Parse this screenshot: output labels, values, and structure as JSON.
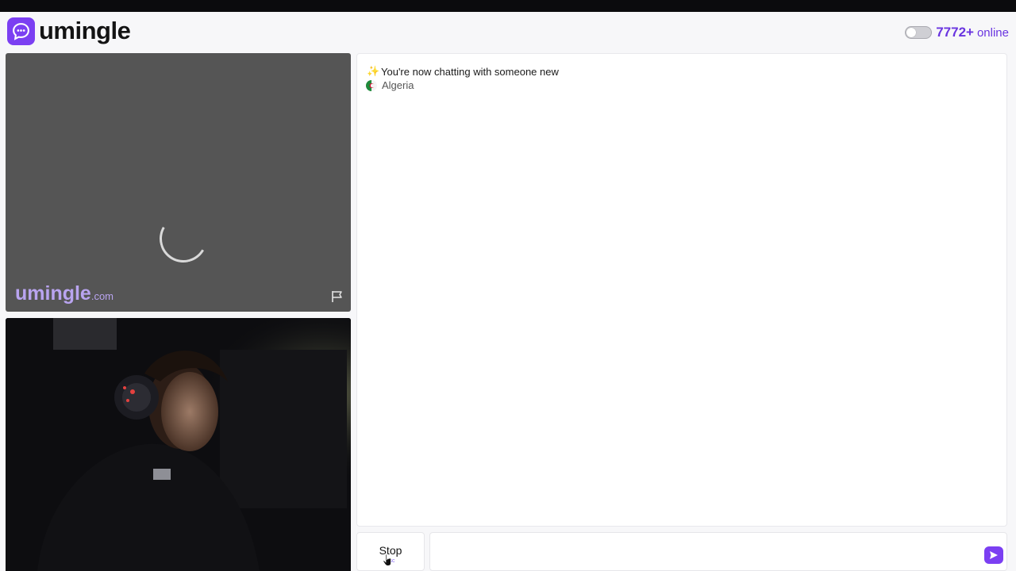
{
  "app": {
    "logo_text": "umingle",
    "accent_color": "#7b3ff2"
  },
  "header": {
    "online_count": "7772+",
    "online_word": "online",
    "toggle_state": "off"
  },
  "remote_video": {
    "watermark_main": "umingle",
    "watermark_suffix": ".com",
    "status": "loading",
    "report_icon": "flag-icon"
  },
  "chat": {
    "system_message": "You're now chatting with someone new",
    "system_icon": "sparkle-icon",
    "country": "Algeria",
    "country_icon": "algeria-flag-icon"
  },
  "controls": {
    "stop_label": "Stop",
    "stop_hint": "esc",
    "message_value": "",
    "send_icon": "send-icon"
  }
}
